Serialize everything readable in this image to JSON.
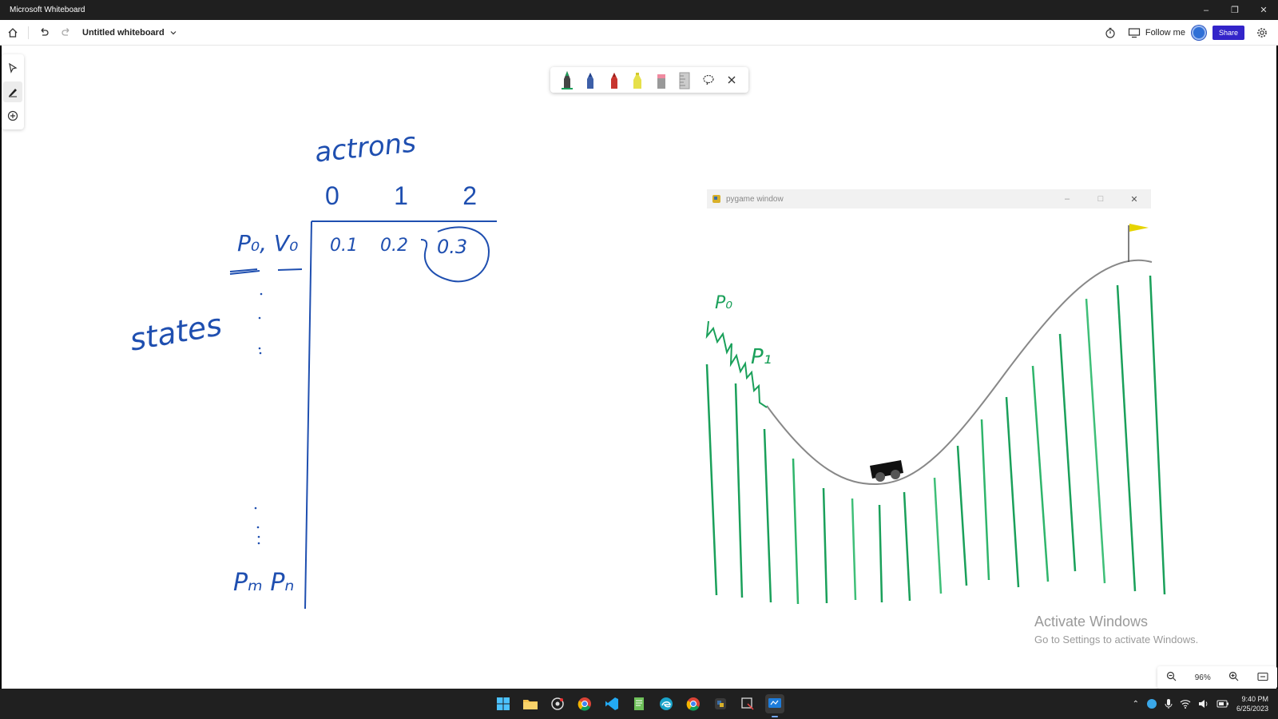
{
  "titlebar": {
    "app_title": "Microsoft Whiteboard"
  },
  "toolbar": {
    "board_title": "Untitled whiteboard",
    "follow_label": "Follow me",
    "share_label": "Share"
  },
  "board": {
    "actions_label": "actrons",
    "action_headers": [
      "0",
      "1",
      "2"
    ],
    "states_label": "states",
    "row_state_label": "P₀, V₀",
    "q_values": [
      "0.1",
      "0.2",
      "0.3"
    ],
    "last_row_label": "Pₘ Pₙ",
    "p0_label": "P₀",
    "p1_label": "P₁"
  },
  "pygame": {
    "window_title": "pygame window"
  },
  "watermark": {
    "title": "Activate Windows",
    "subtitle": "Go to Settings to activate Windows."
  },
  "zoom": {
    "level": "96%"
  },
  "system_tray": {
    "time": "9:40 PM",
    "date": "6/25/2023"
  },
  "colors": {
    "ink_blue": "#1f4fb0",
    "ink_green": "#1aa05a",
    "share": "#3324c9"
  }
}
